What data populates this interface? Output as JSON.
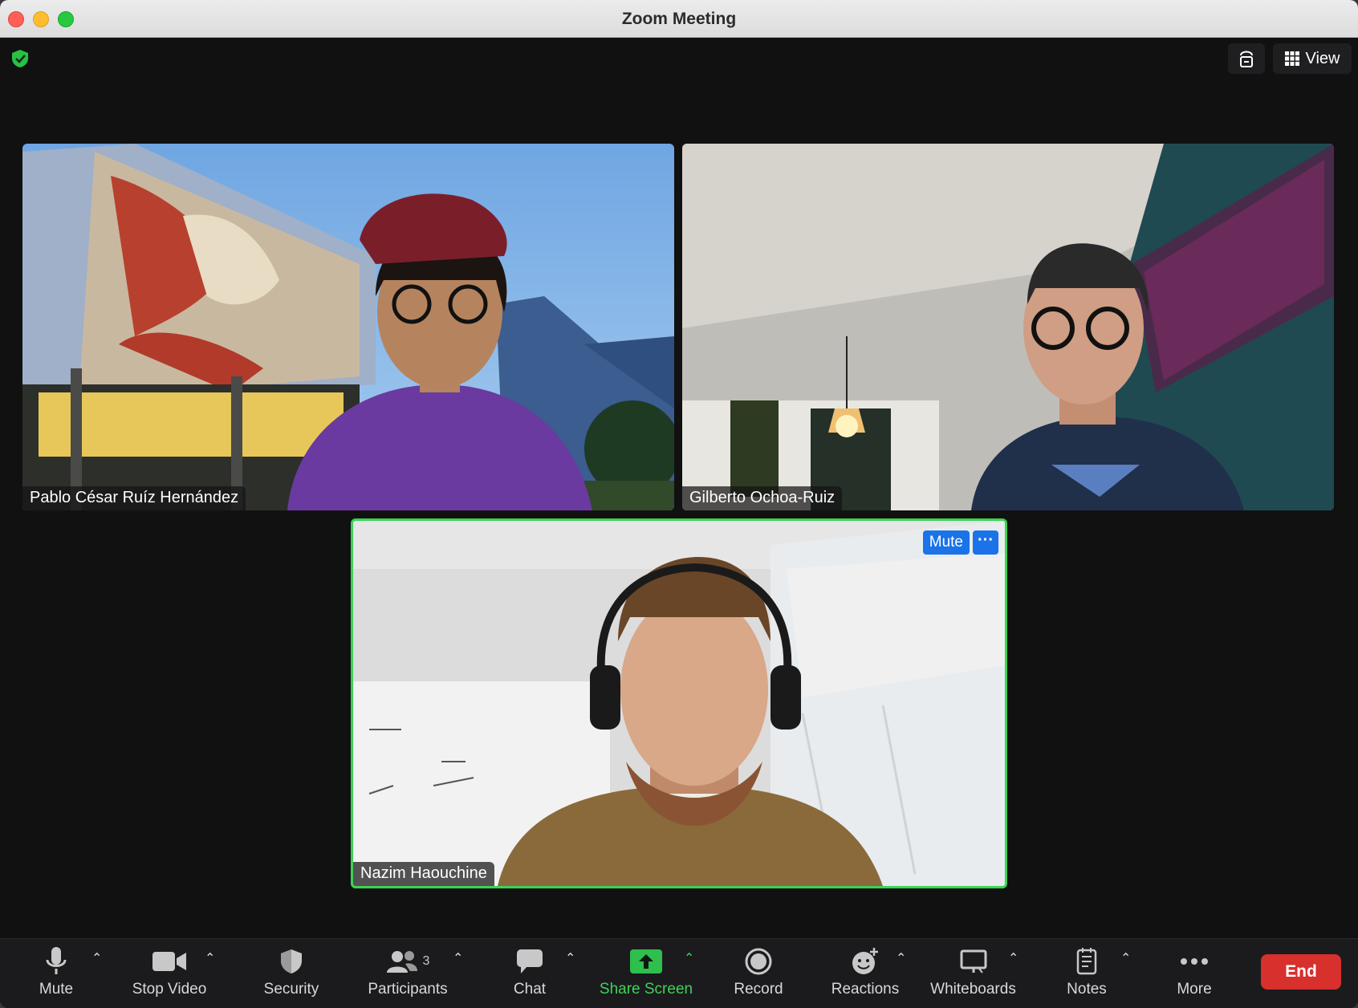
{
  "window": {
    "title": "Zoom Meeting"
  },
  "top_bar": {
    "view_label": "View"
  },
  "participants": [
    {
      "name": "Pablo César Ruíz Hernández"
    },
    {
      "name": "Gilberto Ochoa-Ruiz"
    },
    {
      "name": "Nazim Haouchine",
      "mute_label": "Mute",
      "more_label": "···"
    }
  ],
  "toolbar": {
    "mute": "Mute",
    "stop_video": "Stop Video",
    "security": "Security",
    "participants": "Participants",
    "participants_count": "3",
    "chat": "Chat",
    "share_screen": "Share Screen",
    "record": "Record",
    "reactions": "Reactions",
    "whiteboards": "Whiteboards",
    "notes": "Notes",
    "more": "More",
    "end": "End"
  },
  "colors": {
    "active_speaker_border": "#3bd355",
    "share_green": "#3fd15b",
    "end_red": "#d8302d",
    "mute_blue": "#1a73e8"
  },
  "icons": [
    "shield-check-icon",
    "camera-switch-icon",
    "grid-icon",
    "microphone-icon",
    "video-camera-icon",
    "security-shield-icon",
    "participants-icon",
    "chat-bubble-icon",
    "share-screen-icon",
    "record-icon",
    "reactions-icon",
    "whiteboard-icon",
    "notes-icon",
    "more-dots-icon",
    "caret-up-icon"
  ]
}
